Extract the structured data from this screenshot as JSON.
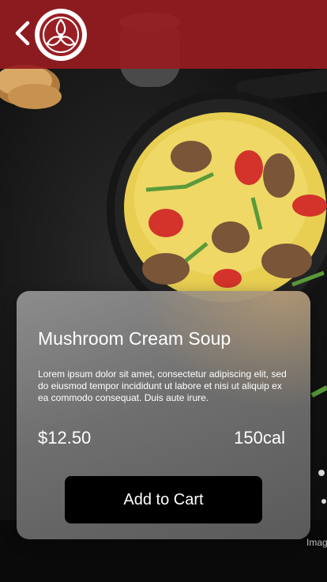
{
  "app": {
    "back_label": "Back",
    "logo_name": "restaurant-logo"
  },
  "product": {
    "title": "Mushroom Cream Soup",
    "description": "Lorem ipsum dolor sit amet, consectetur adipiscing elit, sed do eiusmod tempor incididunt ut labore et  nisi ut aliquip ex ea commodo consequat. Duis aute irure.",
    "price": "$12.50",
    "calories": "150cal",
    "add_to_cart_label": "Add to Cart"
  },
  "background": {
    "caption": "Imag"
  },
  "colors": {
    "topbar": "#961c20",
    "button": "#000000",
    "card": "#8a8a8a",
    "text": "#ffffff"
  }
}
